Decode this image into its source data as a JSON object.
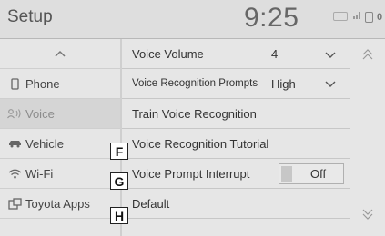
{
  "header": {
    "title": "Setup",
    "clock": "9:25",
    "status_icons": [
      "hdr-badge-icon",
      "signal-icon",
      "phone-status-icon"
    ],
    "count": "0"
  },
  "sidebar": {
    "scroll_up_icon": "chevron-up-icon",
    "items": [
      {
        "label": "Phone",
        "icon": "phone-icon"
      },
      {
        "label": "Voice",
        "icon": "voice-icon",
        "selected": true
      },
      {
        "label": "Vehicle",
        "icon": "car-icon"
      },
      {
        "label": "Wi-Fi",
        "icon": "wifi-icon"
      },
      {
        "label": "Toyota Apps",
        "icon": "apps-icon"
      }
    ]
  },
  "settings": {
    "voice_volume": {
      "label": "Voice Volume",
      "value": "4"
    },
    "voice_recognition_prompts": {
      "label": "Voice Recognition Prompts",
      "value": "High"
    },
    "train_voice_recognition": {
      "label": "Train Voice Recognition"
    },
    "voice_recognition_tutorial": {
      "label": "Voice Recognition Tutorial"
    },
    "voice_prompt_interrupt": {
      "label": "Voice Prompt Interrupt",
      "value": "Off"
    },
    "default": {
      "label": "Default"
    }
  },
  "callouts": [
    "F",
    "G",
    "H"
  ],
  "scroll": {
    "up_icon": "chevron-double-up-icon",
    "down_icon": "chevron-double-down-icon"
  },
  "colors": {
    "background": "#e6e6e6",
    "header": "#dedede",
    "selected": "#d5d5d5",
    "text": "#333333"
  }
}
